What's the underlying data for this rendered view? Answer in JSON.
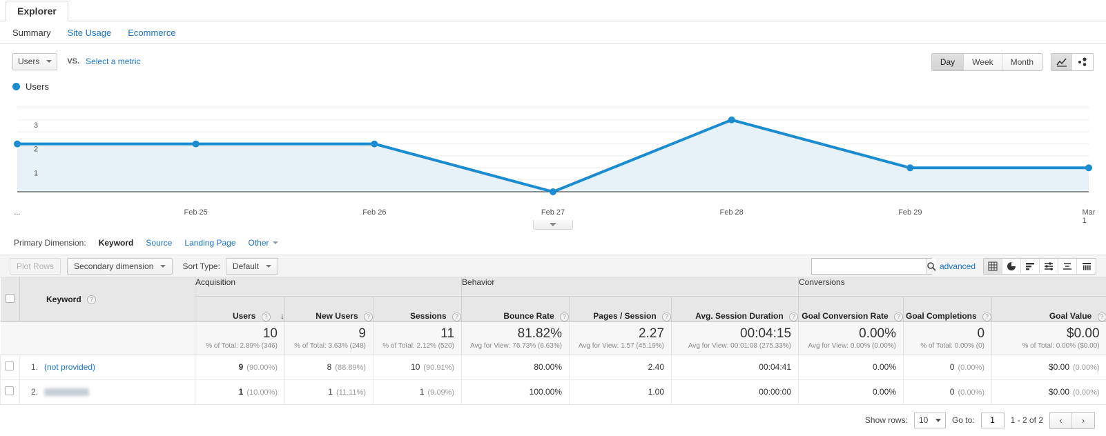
{
  "explorer": {
    "tab_label": "Explorer"
  },
  "subtabs": [
    {
      "label": "Summary",
      "active": true
    },
    {
      "label": "Site Usage",
      "active": false
    },
    {
      "label": "Ecommerce",
      "active": false
    }
  ],
  "metric_bar": {
    "primary_metric": "Users",
    "vs_label": "VS.",
    "select_metric_link": "Select a metric",
    "granularity": [
      {
        "label": "Day",
        "selected": true
      },
      {
        "label": "Week",
        "selected": false
      },
      {
        "label": "Month",
        "selected": false
      }
    ],
    "chart_type_icons": [
      {
        "name": "line-chart-icon",
        "selected": true
      },
      {
        "name": "motion-chart-icon",
        "selected": false
      }
    ]
  },
  "chart_data": {
    "type": "area",
    "title": "",
    "legend": "Users",
    "legend_position": "top-left",
    "series": [
      {
        "name": "Users",
        "values": [
          2,
          2,
          2,
          0,
          3,
          1,
          1
        ],
        "color": "#1c8cd0"
      }
    ],
    "categories": [
      "...",
      "Feb 25",
      "Feb 26",
      "Feb 27",
      "Feb 28",
      "Feb 29",
      "Mar 1"
    ],
    "x_tick_labels": [
      "...",
      "Feb 25",
      "Feb 26",
      "Feb 27",
      "Feb 28",
      "Feb 29",
      "Mar 1"
    ],
    "y_tick_labels": [
      "1",
      "2",
      "3"
    ],
    "ylim": [
      0,
      3.6
    ],
    "ylabel": "",
    "xlabel": "",
    "grid": true,
    "fill_color": "#e6f1f8"
  },
  "primary_dimension": {
    "label": "Primary Dimension:",
    "options": [
      {
        "label": "Keyword",
        "active": true
      },
      {
        "label": "Source",
        "active": false
      },
      {
        "label": "Landing Page",
        "active": false
      },
      {
        "label": "Other",
        "active": false,
        "has_caret": true
      }
    ]
  },
  "table_toolbar": {
    "plot_rows_label": "Plot Rows",
    "secondary_dimension_label": "Secondary dimension",
    "sort_type_label": "Sort Type:",
    "sort_type_value": "Default",
    "search_value": "",
    "search_placeholder": "",
    "advanced_link": "advanced",
    "view_icons": [
      {
        "name": "table-view-icon",
        "selected": true
      },
      {
        "name": "percentage-view-icon",
        "selected": false
      },
      {
        "name": "performance-view-icon",
        "selected": false
      },
      {
        "name": "comparison-view-icon",
        "selected": false
      },
      {
        "name": "term-cloud-view-icon",
        "selected": false
      },
      {
        "name": "pivot-view-icon",
        "selected": false
      }
    ]
  },
  "table": {
    "dimension_header": "Keyword",
    "groups": [
      {
        "label": "Acquisition",
        "span": 3
      },
      {
        "label": "Behavior",
        "span": 3
      },
      {
        "label": "Conversions",
        "span": 3
      }
    ],
    "columns": [
      {
        "label": "Users",
        "sorted": true,
        "sort_dir": "desc"
      },
      {
        "label": "New Users",
        "sorted": false
      },
      {
        "label": "Sessions",
        "sorted": false
      },
      {
        "label": "Bounce Rate",
        "sorted": false
      },
      {
        "label": "Pages / Session",
        "sorted": false
      },
      {
        "label": "Avg. Session Duration",
        "sorted": false
      },
      {
        "label": "Goal Conversion Rate",
        "sorted": false
      },
      {
        "label": "Goal Completions",
        "sorted": false
      },
      {
        "label": "Goal Value",
        "sorted": false
      }
    ],
    "totals": [
      {
        "value": "10",
        "sub": "% of Total: 2.89% (346)"
      },
      {
        "value": "9",
        "sub": "% of Total: 3.63% (248)"
      },
      {
        "value": "11",
        "sub": "% of Total: 2.12% (520)"
      },
      {
        "value": "81.82%",
        "sub": "Avg for View: 76.73% (6.63%)"
      },
      {
        "value": "2.27",
        "sub": "Avg for View: 1.57 (45.19%)"
      },
      {
        "value": "00:04:15",
        "sub": "Avg for View: 00:01:08 (275.33%)"
      },
      {
        "value": "0.00%",
        "sub": "Avg for View: 0.00% (0.00%)"
      },
      {
        "value": "0",
        "sub": "% of Total: 0.00% (0)"
      },
      {
        "value": "$0.00",
        "sub": "% of Total: 0.00% ($0.00)"
      }
    ],
    "rows": [
      {
        "index": "1.",
        "keyword": "(not provided)",
        "redacted": false,
        "cells": [
          {
            "value": "9",
            "pct": "(90.00%)",
            "bold": true
          },
          {
            "value": "8",
            "pct": "(88.89%)",
            "bold": false
          },
          {
            "value": "10",
            "pct": "(90.91%)",
            "bold": false
          },
          {
            "value": "80.00%",
            "pct": "",
            "bold": false
          },
          {
            "value": "2.40",
            "pct": "",
            "bold": false
          },
          {
            "value": "00:04:41",
            "pct": "",
            "bold": false
          },
          {
            "value": "0.00%",
            "pct": "",
            "bold": false
          },
          {
            "value": "0",
            "pct": "(0.00%)",
            "bold": false
          },
          {
            "value": "$0.00",
            "pct": "(0.00%)",
            "bold": false
          }
        ]
      },
      {
        "index": "2.",
        "keyword": "",
        "redacted": true,
        "cells": [
          {
            "value": "1",
            "pct": "(10.00%)",
            "bold": true
          },
          {
            "value": "1",
            "pct": "(11.11%)",
            "bold": false
          },
          {
            "value": "1",
            "pct": "(9.09%)",
            "bold": false
          },
          {
            "value": "100.00%",
            "pct": "",
            "bold": false
          },
          {
            "value": "1.00",
            "pct": "",
            "bold": false
          },
          {
            "value": "00:00:00",
            "pct": "",
            "bold": false
          },
          {
            "value": "0.00%",
            "pct": "",
            "bold": false
          },
          {
            "value": "0",
            "pct": "(0.00%)",
            "bold": false
          },
          {
            "value": "$0.00",
            "pct": "(0.00%)",
            "bold": false
          }
        ]
      }
    ]
  },
  "footer": {
    "show_rows_label": "Show rows:",
    "show_rows_value": "10",
    "goto_label": "Go to:",
    "goto_value": "1",
    "range_label": "1 - 2 of 2",
    "prev_glyph": "‹",
    "next_glyph": "›"
  },
  "colors": {
    "accent_blue": "#1c8cd0",
    "link_blue": "#1a73c8",
    "chart_fill": "#e6f1f8"
  }
}
